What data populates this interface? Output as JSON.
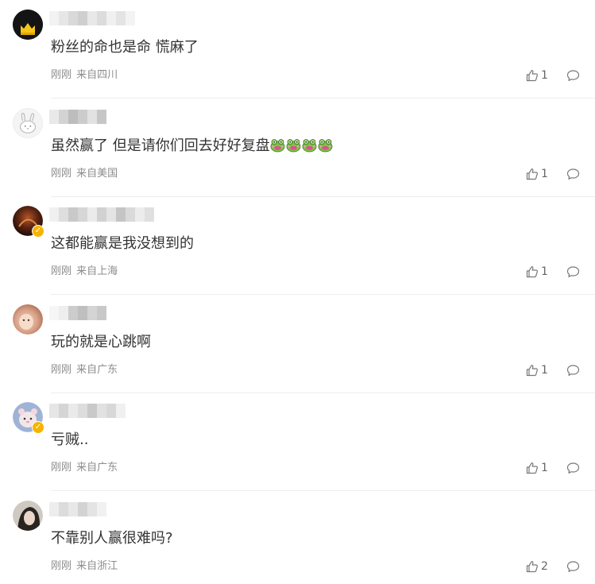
{
  "comments": [
    {
      "content": "粉丝的命也是命 慌麻了",
      "time": "刚刚",
      "location": "来自四川",
      "likes": "1",
      "verified": false,
      "avatar_style": "crown"
    },
    {
      "content": "虽然赢了 但是请你们回去好好复盘",
      "emoji_count": 4,
      "emoji_name": "frog-emoji",
      "time": "刚刚",
      "location": "来自美国",
      "likes": "1",
      "verified": false,
      "avatar_style": "bunny"
    },
    {
      "content": "这都能赢是我没想到的",
      "time": "刚刚",
      "location": "来自上海",
      "likes": "1",
      "verified": true,
      "avatar_style": "dark"
    },
    {
      "content": "玩的就是心跳啊",
      "time": "刚刚",
      "location": "来自广东",
      "likes": "1",
      "verified": false,
      "avatar_style": "baby"
    },
    {
      "content": "亏贼..",
      "time": "刚刚",
      "location": "来自广东",
      "likes": "1",
      "verified": true,
      "avatar_style": "toy"
    },
    {
      "content": "不靠别人赢很难吗?",
      "time": "刚刚",
      "location": "来自浙江",
      "likes": "2",
      "verified": false,
      "avatar_style": "photo"
    }
  ],
  "colors": {
    "text": "#333333",
    "meta": "#8c8c8c",
    "verified_badge": "#f6b400",
    "divider": "#eeeeee"
  },
  "icons": {
    "like": "thumbs-up-icon",
    "reply": "comment-bubble-icon",
    "verified": "verified-v-badge"
  }
}
